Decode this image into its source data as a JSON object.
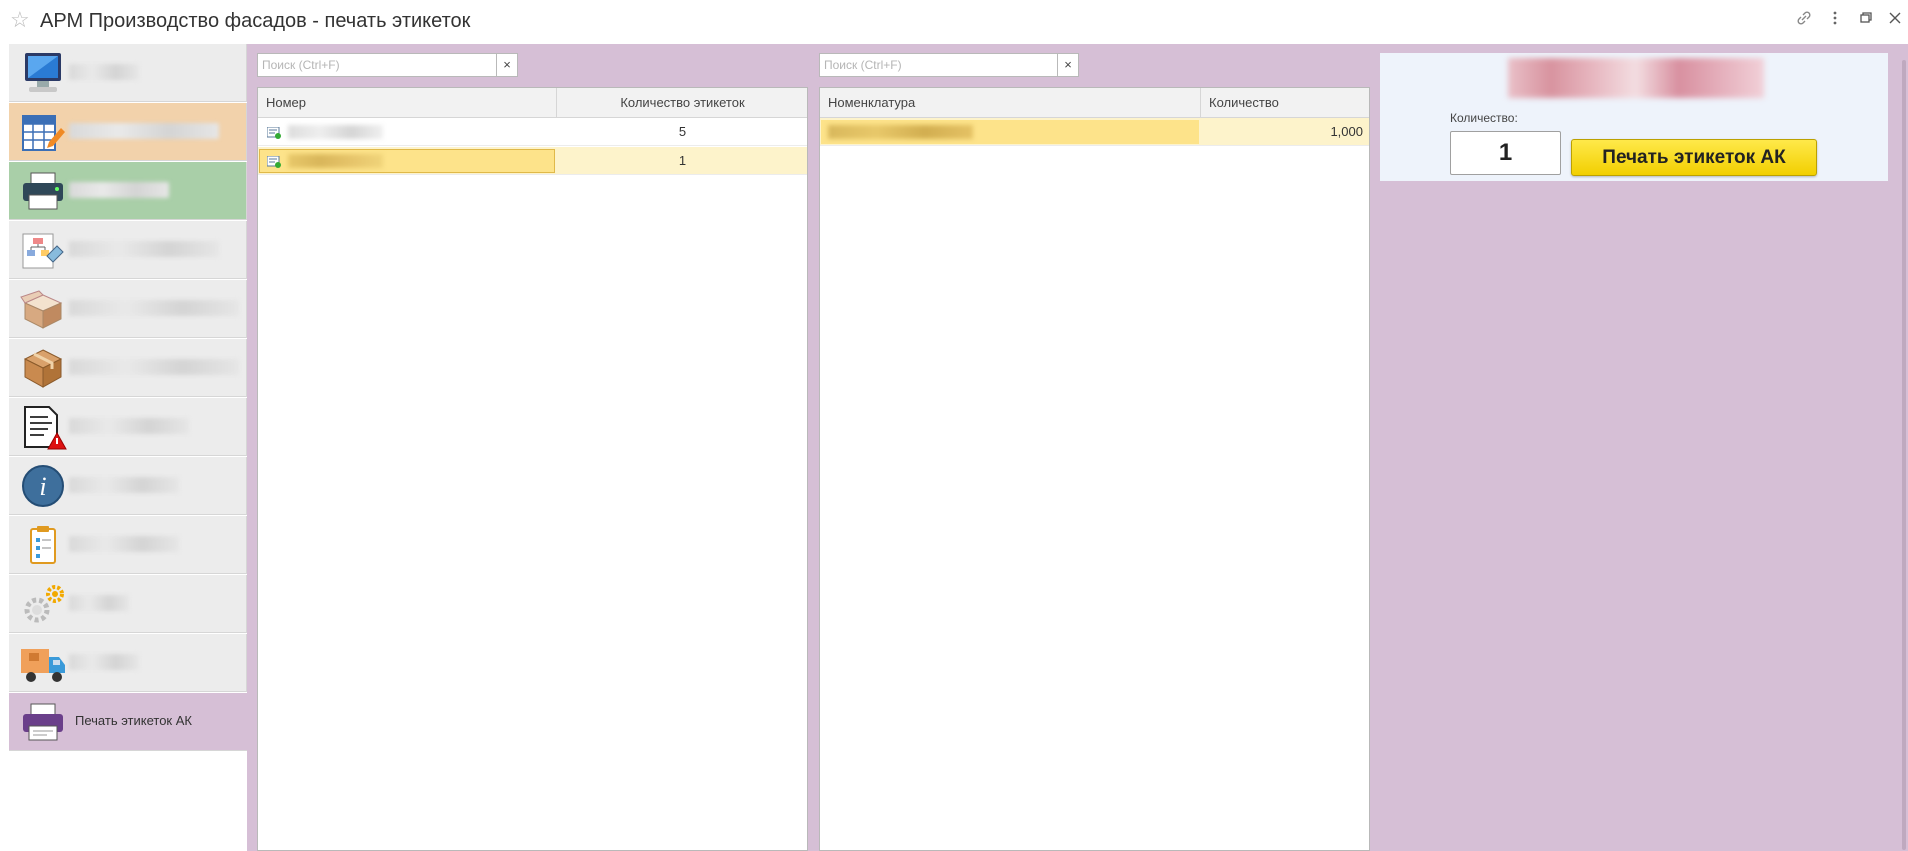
{
  "window": {
    "title": "АРМ Производство фасадов - печать этикеток",
    "icons": [
      "star-icon",
      "link-icon",
      "more-icon",
      "restore-icon",
      "close-icon"
    ]
  },
  "sidebar": {
    "items": [
      {
        "name": "computer",
        "label": "",
        "blurred": true
      },
      {
        "name": "table-edit",
        "label": "",
        "blurred": true
      },
      {
        "name": "printer",
        "label": "",
        "blurred": true
      },
      {
        "name": "diagram",
        "label": "",
        "blurred": true
      },
      {
        "name": "box-open",
        "label": "",
        "blurred": true
      },
      {
        "name": "box",
        "label": "",
        "blurred": true
      },
      {
        "name": "document-warning",
        "label": "",
        "blurred": true
      },
      {
        "name": "info",
        "label": "",
        "blurred": true
      },
      {
        "name": "clipboard",
        "label": "",
        "blurred": true
      },
      {
        "name": "settings",
        "label": "",
        "blurred": true
      },
      {
        "name": "truck",
        "label": "",
        "blurred": true
      },
      {
        "name": "print-labels",
        "label": "Печать этикеток АК",
        "blurred": false
      }
    ]
  },
  "left_table": {
    "search_placeholder": "Поиск (Ctrl+F)",
    "clear": "×",
    "columns": [
      "Номер",
      "Количество этикеток"
    ],
    "rows": [
      {
        "number": "",
        "count": "5"
      },
      {
        "number": "",
        "count": "1"
      }
    ]
  },
  "right_table": {
    "search_placeholder": "Поиск (Ctrl+F)",
    "clear": "×",
    "columns": [
      "Номенклатура",
      "Количество"
    ],
    "rows": [
      {
        "item": "",
        "qty": "1,000"
      }
    ]
  },
  "panel": {
    "qty_label": "Количество:",
    "qty_value": "1",
    "print_button": "Печать этикеток АК"
  },
  "colors": {
    "accent": "#d6bfd6",
    "selection": "#fde38a",
    "button": "#f7d800"
  }
}
